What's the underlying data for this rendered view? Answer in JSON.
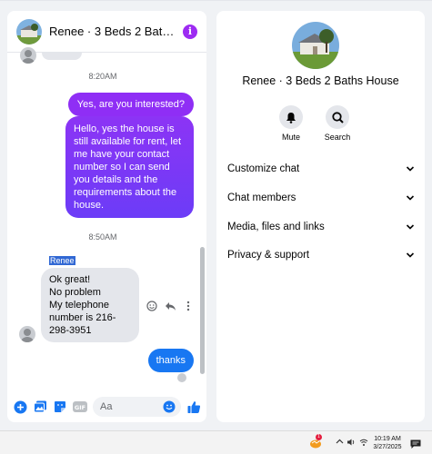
{
  "chat": {
    "title": "Renee · 3 Beds 2 Baths House",
    "timestamps": [
      "8:20AM",
      "8:50AM"
    ],
    "messages": {
      "out1": "Yes, are you interested?",
      "out2": "Hello, yes the house is still available for rent, let me have your contact number so I can send you details and the requirements about the house.",
      "sender": "Renee",
      "in1_lines": [
        "Ok great!",
        "No problem",
        "My telephone",
        "number is 216-",
        "298-3951"
      ],
      "out3": "thanks"
    },
    "composer": {
      "placeholder": "Aa"
    },
    "icons": [
      "info-icon",
      "plus-circle-icon",
      "photo-icon",
      "sticker-icon",
      "gif-icon",
      "emoji-icon",
      "thumbs-up-icon",
      "react-icon",
      "reply-icon",
      "more-icon"
    ]
  },
  "info_panel": {
    "name": "Renee · 3 Beds 2 Baths House",
    "actions": [
      {
        "label": "Mute",
        "icon": "bell-icon"
      },
      {
        "label": "Search",
        "icon": "search-icon"
      }
    ],
    "sections": [
      "Customize chat",
      "Chat members",
      "Media, files and links",
      "Privacy & support"
    ]
  },
  "taskbar": {
    "time": "10:19 AM",
    "date": "3/27/2025",
    "app_badge": "1",
    "icons": [
      "messenger-tray-icon",
      "chevron-up-icon",
      "speaker-icon",
      "wifi-icon",
      "notification-icon"
    ]
  },
  "colors": {
    "accent": "#9d2bf2",
    "blue": "#1877f2",
    "bubble_gray": "#e4e6eb"
  }
}
